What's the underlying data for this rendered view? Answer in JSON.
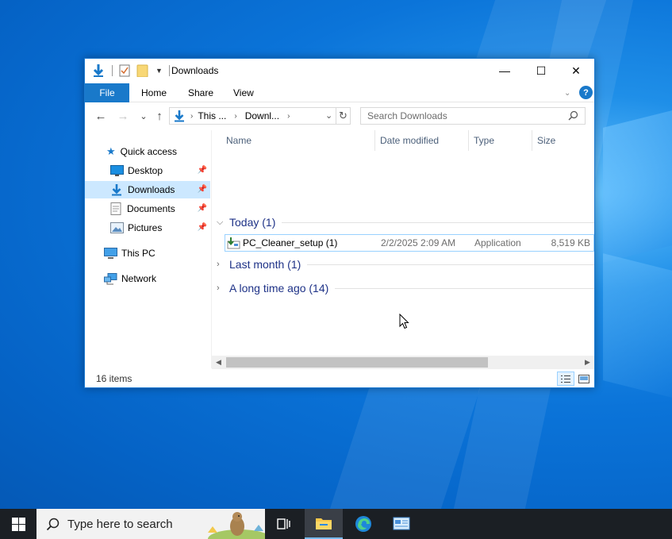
{
  "window": {
    "title": "Downloads",
    "minimize_glyph": "—",
    "maximize_glyph": "☐",
    "close_glyph": "✕"
  },
  "ribbon": {
    "tabs": [
      "File",
      "Home",
      "Share",
      "View"
    ],
    "help_glyph": "?"
  },
  "navigation": {
    "back_glyph": "←",
    "forward_glyph": "→",
    "recent_glyph": "⌄",
    "up_glyph": "↑",
    "breadcrumb": [
      "This ...",
      "Downl..."
    ],
    "refresh_glyph": "↻"
  },
  "search": {
    "placeholder": "Search Downloads"
  },
  "sidebar": {
    "quick_access": "Quick access",
    "items": [
      {
        "label": "Desktop",
        "icon": "desktop-icon",
        "pinned": true
      },
      {
        "label": "Downloads",
        "icon": "download-icon",
        "pinned": true,
        "selected": true
      },
      {
        "label": "Documents",
        "icon": "documents-icon",
        "pinned": true
      },
      {
        "label": "Pictures",
        "icon": "pictures-icon",
        "pinned": true
      }
    ],
    "this_pc": "This PC",
    "network": "Network"
  },
  "columns": {
    "name": "Name",
    "date_modified": "Date modified",
    "type": "Type",
    "size": "Size"
  },
  "groups": [
    {
      "label": "Today (1)",
      "expanded": true
    },
    {
      "label": "Last month (1)",
      "expanded": false
    },
    {
      "label": "A long time ago (14)",
      "expanded": false
    }
  ],
  "files": [
    {
      "name": "PC_Cleaner_setup (1)",
      "date_modified": "2/2/2025 2:09 AM",
      "type": "Application",
      "size": "8,519 KB"
    }
  ],
  "status": {
    "item_count": "16 items"
  },
  "taskbar": {
    "search_placeholder": "Type here to search",
    "apps": [
      "task-view-icon",
      "file-explorer-icon",
      "edge-icon",
      "control-panel-icon"
    ]
  },
  "colors": {
    "accent": "#1979ca",
    "selection": "#cce8ff",
    "group_text": "#1e3287",
    "taskbar": "#1b1f24"
  }
}
